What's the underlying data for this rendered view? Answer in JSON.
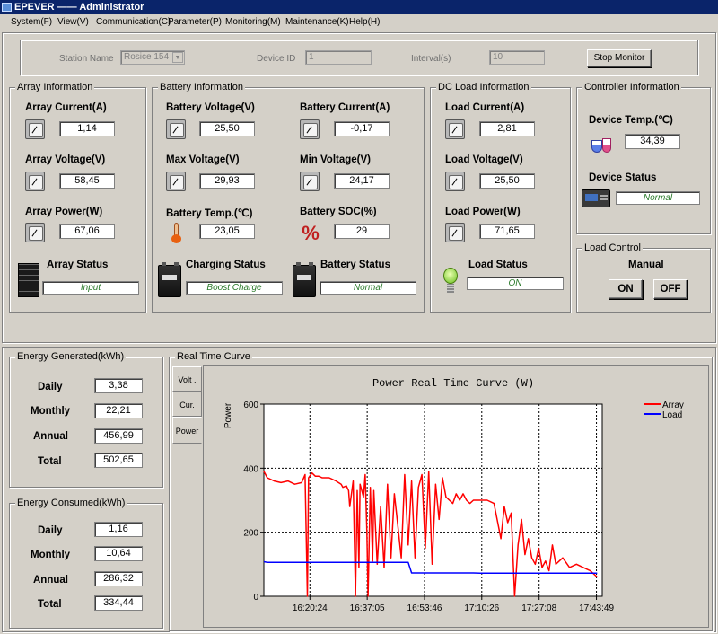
{
  "window": {
    "title": "EPEVER —— Administrator"
  },
  "menu": [
    "System(F)",
    "View(V)",
    "Communication(C)",
    "Parameter(P)",
    "Monitoring(M)",
    "Maintenance(K)",
    "Help(H)"
  ],
  "station": {
    "name_label": "Station Name",
    "name_value": "Rosice 154",
    "device_id_label": "Device ID",
    "device_id_value": "1",
    "interval_label": "Interval(s)",
    "interval_value": "10",
    "stop_button": "Stop Monitor"
  },
  "array_info": {
    "title": "Array Information",
    "current_label": "Array Current(A)",
    "current": "1,14",
    "voltage_label": "Array Voltage(V)",
    "voltage": "58,45",
    "power_label": "Array Power(W)",
    "power": "67,06",
    "status_label": "Array Status",
    "status": "Input"
  },
  "battery_info": {
    "title": "Battery Information",
    "voltage_label": "Battery Voltage(V)",
    "voltage": "25,50",
    "current_label": "Battery Current(A)",
    "current": "-0,17",
    "max_label": "Max Voltage(V)",
    "max": "29,93",
    "min_label": "Min Voltage(V)",
    "min": "24,17",
    "temp_label": "Battery Temp.(℃)",
    "temp": "23,05",
    "soc_label": "Battery SOC(%)",
    "soc": "29",
    "charging_label": "Charging Status",
    "charging": "Boost Charge",
    "status_label": "Battery Status",
    "status": "Normal"
  },
  "load_info": {
    "title": "DC Load Information",
    "current_label": "Load Current(A)",
    "current": "2,81",
    "voltage_label": "Load Voltage(V)",
    "voltage": "25,50",
    "power_label": "Load Power(W)",
    "power": "71,65",
    "status_label": "Load Status",
    "status": "ON"
  },
  "controller_info": {
    "title": "Controller Information",
    "temp_label": "Device Temp.(℃)",
    "temp": "34,39",
    "status_label": "Device Status",
    "status": "Normal"
  },
  "load_control": {
    "title": "Load Control",
    "mode": "Manual",
    "on": "ON",
    "off": "OFF"
  },
  "energy_generated": {
    "title": "Energy Generated(kWh)",
    "rows": [
      {
        "label": "Daily",
        "value": "3,38"
      },
      {
        "label": "Monthly",
        "value": "22,21"
      },
      {
        "label": "Annual",
        "value": "456,99"
      },
      {
        "label": "Total",
        "value": "502,65"
      }
    ]
  },
  "energy_consumed": {
    "title": "Energy Consumed(kWh)",
    "rows": [
      {
        "label": "Daily",
        "value": "1,16"
      },
      {
        "label": "Monthly",
        "value": "10,64"
      },
      {
        "label": "Annual",
        "value": "286,32"
      },
      {
        "label": "Total",
        "value": "334,44"
      }
    ]
  },
  "curve": {
    "title": "Real Time Curve",
    "tabs": [
      "Volt .",
      "Cur.",
      "Power"
    ],
    "active_tab": "Power"
  },
  "chart_data": {
    "type": "line",
    "title": "Power Real Time Curve (W)",
    "ylabel": "Power",
    "xlabel": "",
    "ylim": [
      0,
      600
    ],
    "yticks": [
      0,
      200,
      400,
      600
    ],
    "xticks": [
      "16:20:24",
      "16:37:05",
      "16:53:46",
      "17:10:26",
      "17:27:08",
      "17:43:49"
    ],
    "x": [
      "16:07:00",
      "16:08:00",
      "16:10:00",
      "16:12:00",
      "16:14:00",
      "16:16:00",
      "16:18:00",
      "16:19:00",
      "16:19:40",
      "16:20:00",
      "16:21:00",
      "16:22:00",
      "16:23:00",
      "16:24:00",
      "16:26:00",
      "16:28:00",
      "16:29:30",
      "16:30:00",
      "16:31:00",
      "16:31:40",
      "16:32:00",
      "16:33:00",
      "16:33:40",
      "16:34:10",
      "16:34:40",
      "16:35:00",
      "16:36:00",
      "16:36:30",
      "16:37:00",
      "16:37:20",
      "16:38:00",
      "16:38:40",
      "16:39:00",
      "16:40:00",
      "16:41:00",
      "16:42:00",
      "16:43:00",
      "16:44:00",
      "16:45:00",
      "16:46:00",
      "16:47:00",
      "16:48:00",
      "16:49:00",
      "16:50:00",
      "16:51:00",
      "16:52:00",
      "16:53:00",
      "16:54:00",
      "16:55:00",
      "16:56:00",
      "16:57:00",
      "16:58:00",
      "16:59:00",
      "17:00:00",
      "17:01:00",
      "17:02:00",
      "17:03:00",
      "17:04:00",
      "17:05:00",
      "17:06:00",
      "17:07:00",
      "17:08:00",
      "17:10:00",
      "17:12:00",
      "17:14:00",
      "17:16:00",
      "17:17:00",
      "17:18:00",
      "17:19:00",
      "17:20:00",
      "17:21:00",
      "17:22:00",
      "17:23:00",
      "17:24:00",
      "17:25:00",
      "17:26:00",
      "17:27:00",
      "17:28:00",
      "17:29:00",
      "17:30:00",
      "17:31:00",
      "17:32:00",
      "17:34:00",
      "17:36:00",
      "17:38:00",
      "17:40:00",
      "17:42:00",
      "17:44:00"
    ],
    "series": [
      {
        "name": "Array",
        "color": "#ff0000",
        "values": [
          390,
          370,
          360,
          355,
          360,
          350,
          355,
          380,
          0,
          370,
          385,
          375,
          375,
          370,
          370,
          360,
          350,
          340,
          345,
          330,
          280,
          360,
          0,
          330,
          90,
          350,
          310,
          380,
          200,
          0,
          340,
          110,
          330,
          100,
          280,
          90,
          350,
          120,
          320,
          220,
          120,
          380,
          160,
          360,
          120,
          340,
          380,
          150,
          390,
          100,
          350,
          240,
          370,
          310,
          300,
          290,
          320,
          300,
          320,
          300,
          290,
          300,
          300,
          300,
          290,
          180,
          280,
          230,
          260,
          0,
          160,
          240,
          130,
          180,
          120,
          100,
          150,
          90,
          110,
          80,
          160,
          100,
          120,
          90,
          100,
          90,
          80,
          60
        ]
      },
      {
        "name": "Load",
        "color": "#0000ff",
        "values": [
          108,
          106,
          106,
          106,
          106,
          106,
          106,
          106,
          106,
          106,
          106,
          106,
          106,
          106,
          106,
          106,
          106,
          106,
          106,
          106,
          106,
          106,
          106,
          106,
          106,
          106,
          106,
          106,
          106,
          106,
          106,
          106,
          106,
          106,
          106,
          106,
          106,
          106,
          106,
          106,
          106,
          106,
          106,
          73,
          73,
          73,
          73,
          73,
          73,
          73,
          73,
          73,
          73,
          73,
          73,
          73,
          73,
          73,
          73,
          73,
          73,
          73,
          72,
          72,
          72,
          72,
          72,
          72,
          72,
          72,
          72,
          72,
          72,
          72,
          72,
          72,
          72,
          72,
          72,
          72,
          72,
          72,
          72,
          72,
          72,
          72,
          72,
          72
        ]
      }
    ]
  }
}
